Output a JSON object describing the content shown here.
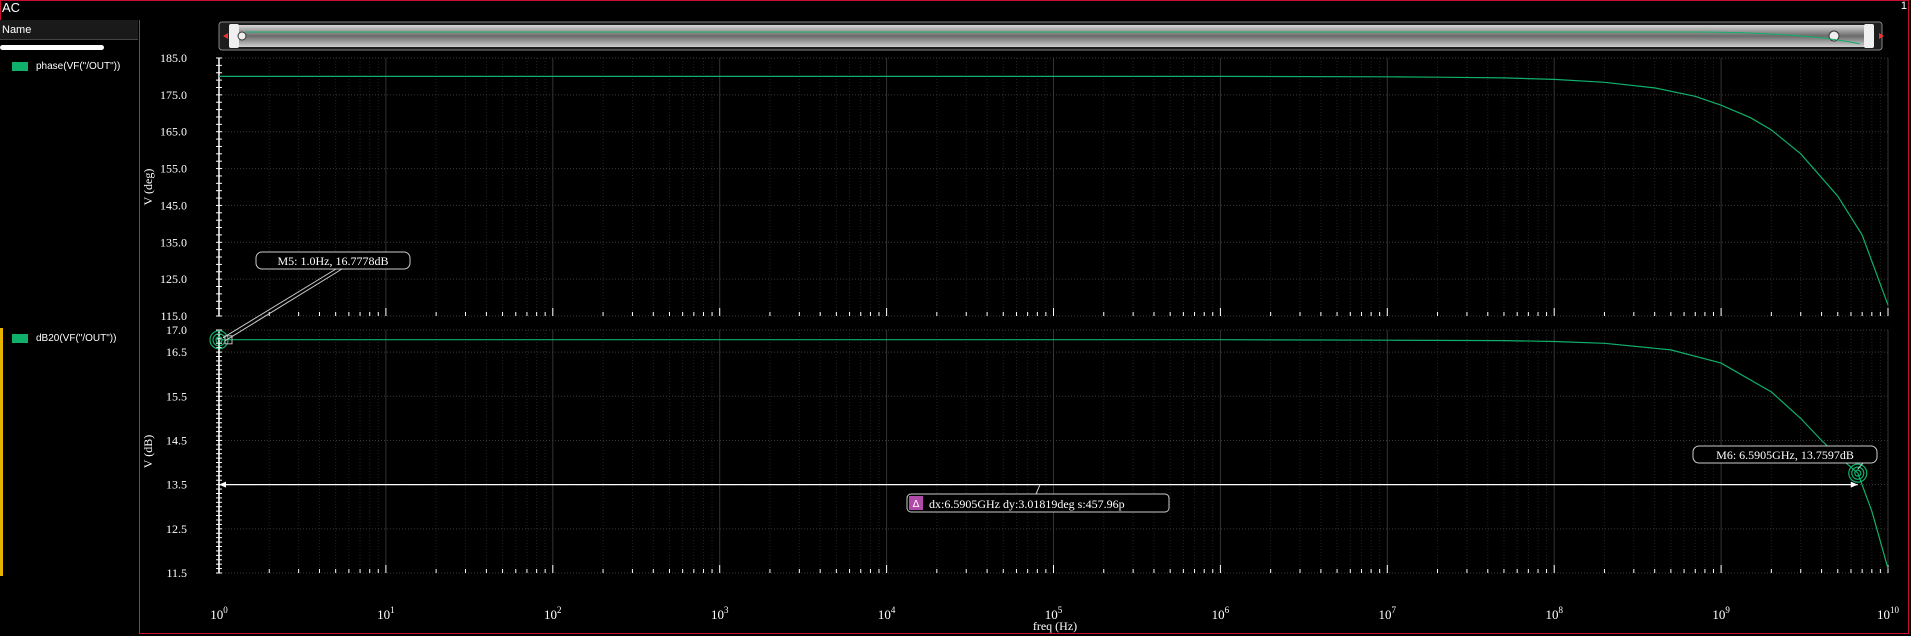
{
  "window": {
    "title": "AC",
    "corner_text": "1"
  },
  "sidebar": {
    "header": "Name",
    "traces": [
      {
        "label": "phase(VF(\"/OUT\"))",
        "color": "#10b06a"
      },
      {
        "label": "dB20(VF(\"/OUT\"))",
        "color": "#10b06a"
      }
    ]
  },
  "scrollbar": {
    "left_handle": "|",
    "right_handle": "|",
    "left_glyph": "D",
    "right_glyph": "m"
  },
  "colors": {
    "trace": "#10b06a",
    "grid": "#3a3a3a",
    "axis": "#ffffff",
    "frame": "#c8102e",
    "delta_badge": "#b04aa8"
  },
  "chart_data": [
    {
      "type": "line",
      "name": "phase",
      "ylabel": "V (deg)",
      "ylim": [
        115.0,
        185.0
      ],
      "yticks": [
        "185.0",
        "175.0",
        "165.0",
        "155.0",
        "145.0",
        "135.0",
        "125.0",
        "115.0"
      ],
      "yscale": "linear",
      "xscale": "log",
      "xlim": [
        1,
        10000000000
      ],
      "series": [
        {
          "name": "phase(VF(\"/OUT\"))",
          "x": [
            1,
            10,
            100,
            1000,
            10000,
            100000,
            1000000,
            10000000,
            20000000,
            50000000,
            100000000,
            200000000,
            400000000,
            700000000,
            1000000000,
            1500000000,
            2000000000,
            3000000000,
            5000000000,
            7000000000,
            10000000000
          ],
          "y": [
            180.0,
            180.0,
            180.0,
            180.0,
            180.0,
            180.0,
            180.0,
            179.9,
            179.8,
            179.6,
            179.2,
            178.4,
            176.9,
            174.6,
            172.2,
            168.8,
            165.5,
            159.0,
            147.5,
            137.0,
            118.0
          ]
        }
      ]
    },
    {
      "type": "line",
      "name": "magnitude",
      "ylabel": "V (dB)",
      "xlabel": "freq (Hz)",
      "ylim": [
        11.5,
        17.0
      ],
      "yticks": [
        "17.0",
        "16.5",
        "15.5",
        "14.5",
        "13.5",
        "12.5",
        "11.5"
      ],
      "yscale": "linear",
      "xscale": "log",
      "xlim": [
        1,
        10000000000
      ],
      "xticks": [
        {
          "base": "10",
          "exp": "0"
        },
        {
          "base": "10",
          "exp": "1"
        },
        {
          "base": "10",
          "exp": "2"
        },
        {
          "base": "10",
          "exp": "3"
        },
        {
          "base": "10",
          "exp": "4"
        },
        {
          "base": "10",
          "exp": "5"
        },
        {
          "base": "10",
          "exp": "6"
        },
        {
          "base": "10",
          "exp": "7"
        },
        {
          "base": "10",
          "exp": "8"
        },
        {
          "base": "10",
          "exp": "9"
        },
        {
          "base": "10",
          "exp": "10"
        }
      ],
      "series": [
        {
          "name": "dB20(VF(\"/OUT\"))",
          "x": [
            1,
            10,
            100,
            1000,
            10000,
            100000,
            1000000,
            10000000,
            50000000,
            100000000,
            200000000,
            500000000,
            1000000000,
            2000000000,
            3000000000,
            4000000000,
            5000000000,
            6590500000,
            8000000000,
            10000000000
          ],
          "y": [
            16.78,
            16.78,
            16.78,
            16.78,
            16.78,
            16.78,
            16.78,
            16.77,
            16.76,
            16.74,
            16.7,
            16.55,
            16.25,
            15.6,
            15.0,
            14.5,
            14.15,
            13.76,
            12.9,
            11.6
          ]
        }
      ],
      "markers": [
        {
          "id": "M5",
          "label": "M5: 1.0Hz, 16.7778dB",
          "x": 1.0,
          "y": 16.7778
        },
        {
          "id": "M6",
          "label": "M6: 6.5905GHz, 13.7597dB",
          "x": 6590500000,
          "y": 13.7597
        }
      ],
      "delta": {
        "badge": "Δ",
        "label": "dx:6.5905GHz dy:3.01819deg s:457.96p",
        "y": 13.5
      }
    }
  ]
}
